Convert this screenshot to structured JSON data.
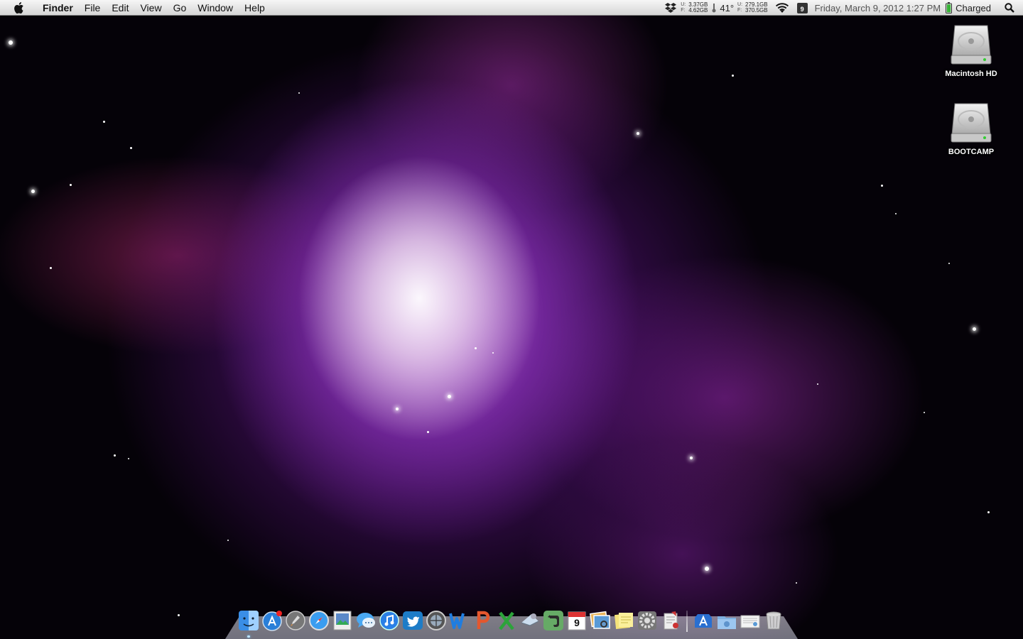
{
  "menubar": {
    "apple_icon": "apple-icon",
    "app_name": "Finder",
    "menus": [
      "File",
      "Edit",
      "View",
      "Go",
      "Window",
      "Help"
    ],
    "status": {
      "dropbox_icon": "dropbox-icon",
      "memory_labels": [
        "U:",
        "F:"
      ],
      "memory_values": [
        "3.37GB",
        "4.62GB"
      ],
      "temperature": "41°",
      "disk_labels": [
        "U:",
        "F:"
      ],
      "disk_values": [
        "279.1GB",
        "370.5GB"
      ],
      "wifi_icon": "wifi-icon",
      "calendar_day": "9",
      "datetime": "Friday, March 9, 2012  1:27 PM",
      "battery_status": "Charged",
      "spotlight_icon": "spotlight-icon"
    }
  },
  "desktop": {
    "icons": [
      {
        "label": "Macintosh HD",
        "icon": "hard-drive-icon"
      },
      {
        "label": "BOOTCAMP",
        "icon": "hard-drive-icon"
      }
    ]
  },
  "dock": {
    "calendar_day": "9",
    "apps": [
      {
        "name": "Finder",
        "icon": "finder-icon",
        "running": true
      },
      {
        "name": "App Store",
        "icon": "app-store-icon",
        "badge": true
      },
      {
        "name": "Launchpad",
        "icon": "launchpad-icon"
      },
      {
        "name": "Safari",
        "icon": "safari-icon"
      },
      {
        "name": "Preview",
        "icon": "preview-icon"
      },
      {
        "name": "Messages",
        "icon": "messages-icon"
      },
      {
        "name": "iTunes",
        "icon": "itunes-icon"
      },
      {
        "name": "Twitter",
        "icon": "twitter-icon"
      },
      {
        "name": "System Information",
        "icon": "system-information-icon"
      },
      {
        "name": "Word",
        "icon": "word-icon"
      },
      {
        "name": "PowerPoint",
        "icon": "powerpoint-icon"
      },
      {
        "name": "Excel",
        "icon": "excel-icon"
      },
      {
        "name": "Mail",
        "icon": "mail-icon"
      },
      {
        "name": "Evernote",
        "icon": "evernote-icon"
      },
      {
        "name": "iCal",
        "icon": "calendar-icon"
      },
      {
        "name": "iPhoto",
        "icon": "iphoto-icon"
      },
      {
        "name": "Stickies",
        "icon": "stickies-icon"
      },
      {
        "name": "System Preferences",
        "icon": "system-preferences-icon"
      },
      {
        "name": "Script Editor",
        "icon": "script-editor-icon"
      }
    ],
    "right_items": [
      {
        "name": "Applications",
        "icon": "applications-stack-icon"
      },
      {
        "name": "Downloads",
        "icon": "downloads-folder-icon"
      },
      {
        "name": "Documents",
        "icon": "documents-stack-icon"
      },
      {
        "name": "Trash",
        "icon": "trash-icon"
      }
    ]
  },
  "colors": {
    "menubar_top": "#f6f6f6",
    "menubar_bottom": "#d6d6d6",
    "wallpaper_purple": "#8a2fbf",
    "wallpaper_magenta": "#b0287a"
  }
}
